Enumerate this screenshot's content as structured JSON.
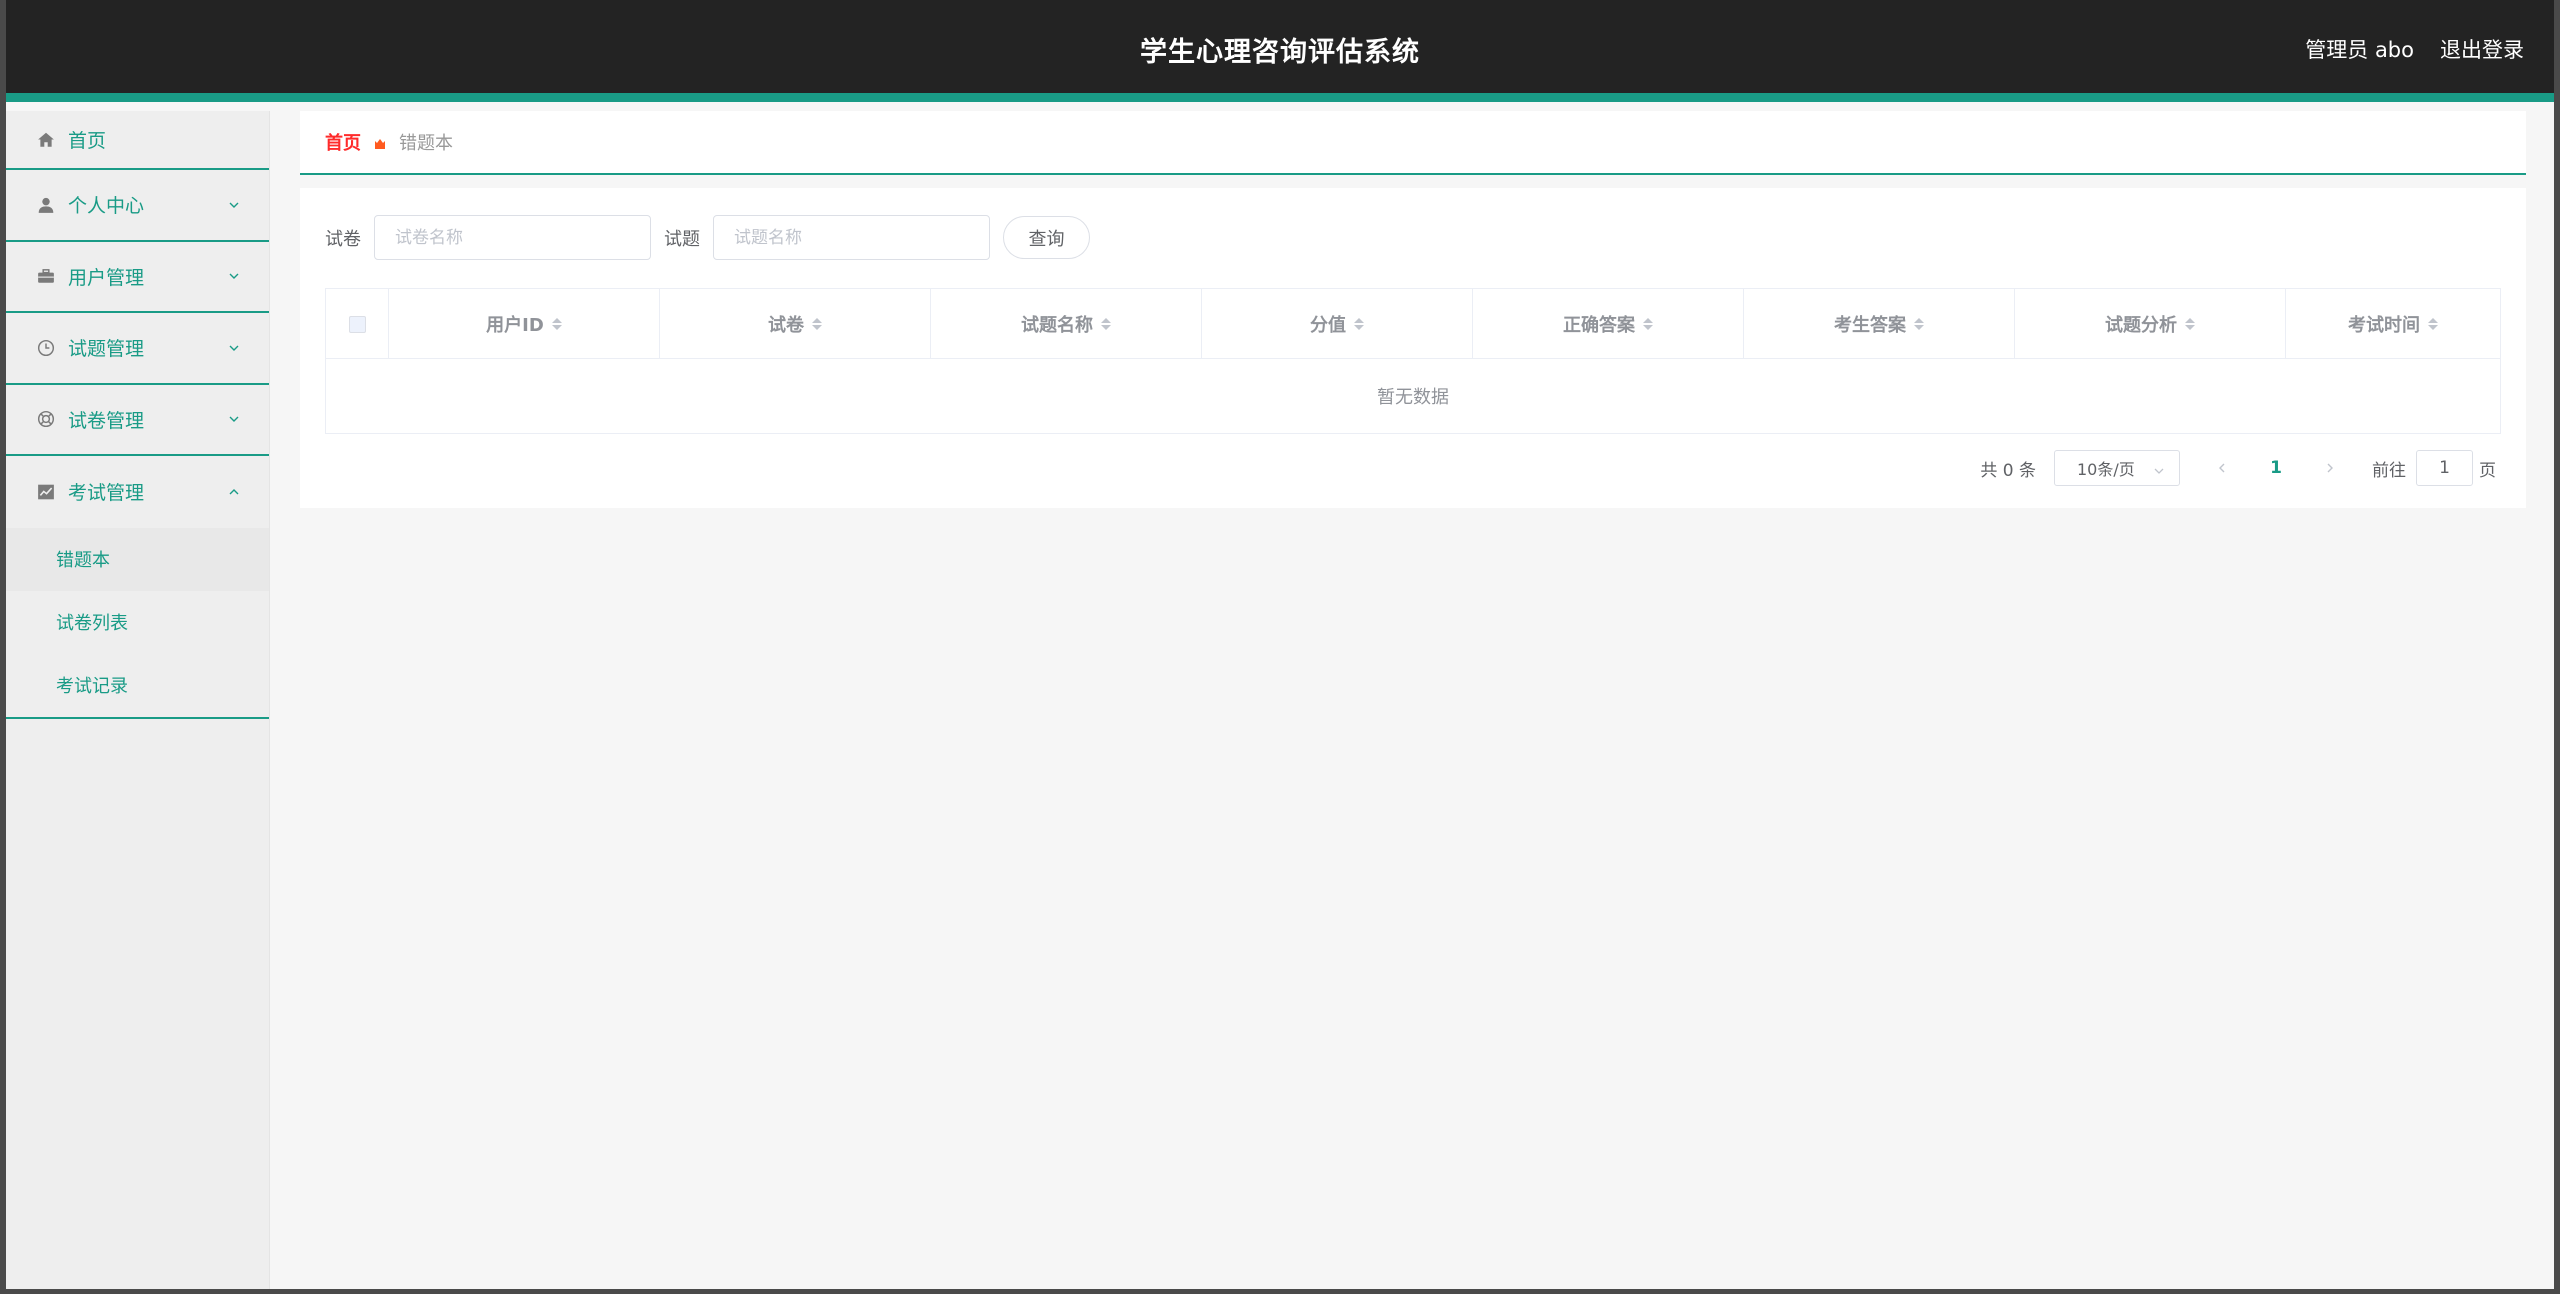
{
  "header": {
    "title": "学生心理咨询评估系统",
    "user_label": "管理员 abo",
    "logout_label": "退出登录"
  },
  "sidebar": {
    "items": [
      {
        "label": "首页",
        "icon": "home-icon"
      },
      {
        "label": "个人中心",
        "icon": "user-icon",
        "expanded": false
      },
      {
        "label": "用户管理",
        "icon": "briefcase-icon",
        "expanded": false
      },
      {
        "label": "试题管理",
        "icon": "clock-icon",
        "expanded": false
      },
      {
        "label": "试卷管理",
        "icon": "lifebuoy-icon",
        "expanded": false
      },
      {
        "label": "考试管理",
        "icon": "chart-icon",
        "expanded": true
      }
    ],
    "subitems": [
      {
        "label": "错题本",
        "active": true
      },
      {
        "label": "试卷列表",
        "active": false
      },
      {
        "label": "考试记录",
        "active": false
      }
    ]
  },
  "breadcrumb": {
    "home": "首页",
    "current": "错题本"
  },
  "search": {
    "paper_label": "试卷",
    "paper_placeholder": "试卷名称",
    "question_label": "试题",
    "question_placeholder": "试题名称",
    "query_button": "查询"
  },
  "table": {
    "columns": [
      "用户ID",
      "试卷",
      "试题名称",
      "分值",
      "正确答案",
      "考生答案",
      "试题分析",
      "考试时间"
    ],
    "empty_text": "暂无数据"
  },
  "pagination": {
    "total_text": "共 0 条",
    "page_size": "10条/页",
    "current_page": "1",
    "goto_label": "前往",
    "goto_value": "1",
    "page_suffix": "页"
  },
  "colors": {
    "accent": "#199b86",
    "header_bg": "#232323",
    "breadcrumb_home": "#ff2b2b",
    "breadcrumb_sep": "#ff5a1f"
  }
}
